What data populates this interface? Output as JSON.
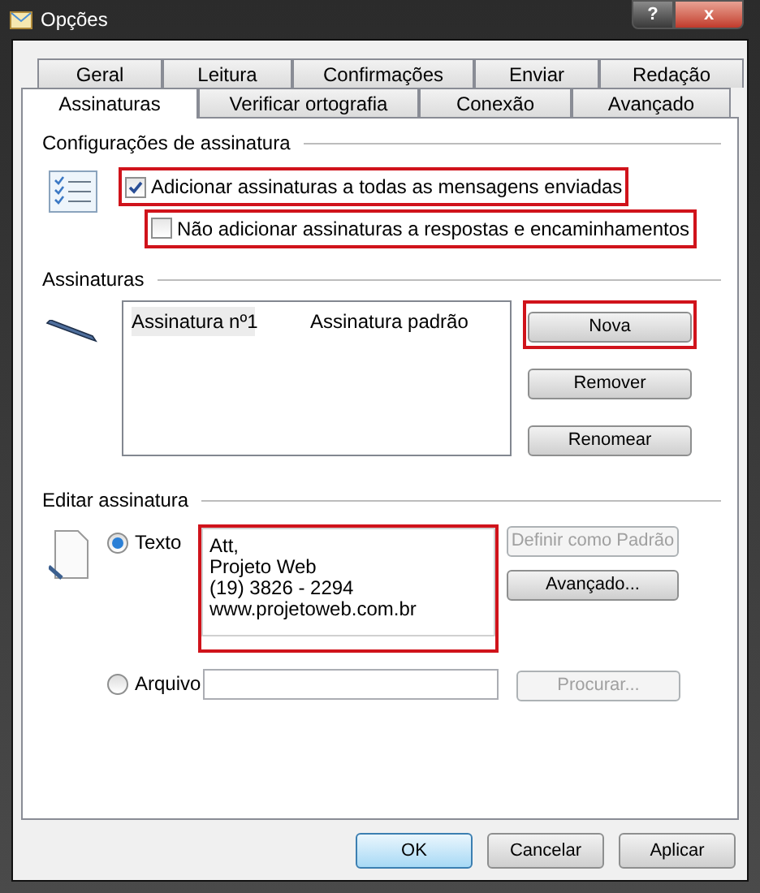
{
  "window": {
    "title": "Opções",
    "help_button": "?",
    "close_button": "x"
  },
  "tab_rows": [
    [
      {
        "label": "Geral",
        "selected": false
      },
      {
        "label": "Leitura",
        "selected": false
      },
      {
        "label": "Confirmações",
        "selected": false
      },
      {
        "label": "Enviar",
        "selected": false
      },
      {
        "label": "Redação",
        "selected": false
      }
    ],
    [
      {
        "label": "Assinaturas",
        "selected": true
      },
      {
        "label": "Verificar ortografia",
        "selected": false
      },
      {
        "label": "Conexão",
        "selected": false
      },
      {
        "label": "Avançado",
        "selected": false
      }
    ]
  ],
  "settings": {
    "heading": "Configurações de assinatura",
    "checkboxes": [
      {
        "label": "Adicionar assinaturas a todas as mensagens enviadas",
        "checked": true,
        "highlighted": true,
        "indented": false
      },
      {
        "label": "Não adicionar assinaturas a respostas e encaminhamentos",
        "checked": false,
        "highlighted": true,
        "indented": true
      }
    ]
  },
  "signatures": {
    "heading": "Assinaturas",
    "rows": [
      {
        "name": "Assinatura nº1",
        "default_label": "Assinatura padrão",
        "selected": true
      }
    ],
    "buttons": [
      {
        "label": "Nova",
        "highlighted": true
      },
      {
        "label": "Remover",
        "highlighted": false
      },
      {
        "label": "Renomear",
        "highlighted": false
      }
    ]
  },
  "edit": {
    "heading": "Editar assinatura",
    "text_option": {
      "label": "Texto",
      "selected": true
    },
    "text_value": "Att,\nProjeto Web\n(19) 3826 - 2294\nwww.projetoweb.com.br",
    "text_highlighted": true,
    "side_buttons": [
      {
        "label": "Definir como Padrão",
        "disabled": true
      },
      {
        "label": "Avançado...",
        "disabled": false
      }
    ],
    "file_option": {
      "label": "Arquivo",
      "selected": false
    },
    "browse_button": {
      "label": "Procurar...",
      "disabled": true
    }
  },
  "footer_buttons": [
    {
      "label": "OK",
      "default": true
    },
    {
      "label": "Cancelar",
      "default": false
    },
    {
      "label": "Aplicar",
      "default": false
    }
  ]
}
